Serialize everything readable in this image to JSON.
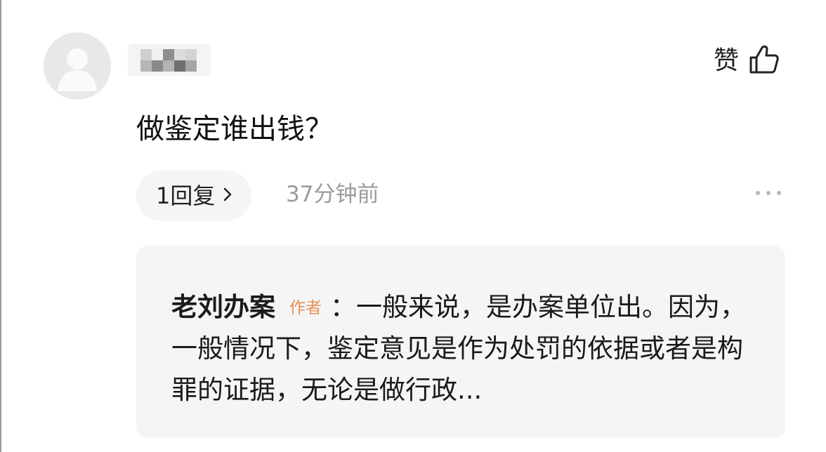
{
  "comment": {
    "avatar_icon": "default-user-icon",
    "username": "",
    "like_label": "赞",
    "like_icon": "thumbs-up-icon",
    "text": "做鉴定谁出钱？",
    "reply_count_label": "1回复",
    "reply_chevron_icon": "chevron-right-icon",
    "time": "37分钟前",
    "more_icon": "more-dots-icon"
  },
  "reply": {
    "author": "老刘办案",
    "badge": "作者",
    "separator": "：",
    "text": "一般来说，是办案单位出。因为，一般情况下，鉴定意见是作为处罚的依据或者是构罪的证据，无论是做行政..."
  },
  "colors": {
    "background": "#ffffff",
    "pill_background": "#f5f5f5",
    "reply_background": "#f5f5f5",
    "muted_text": "#9b9b9b",
    "badge": "#e8905a"
  }
}
